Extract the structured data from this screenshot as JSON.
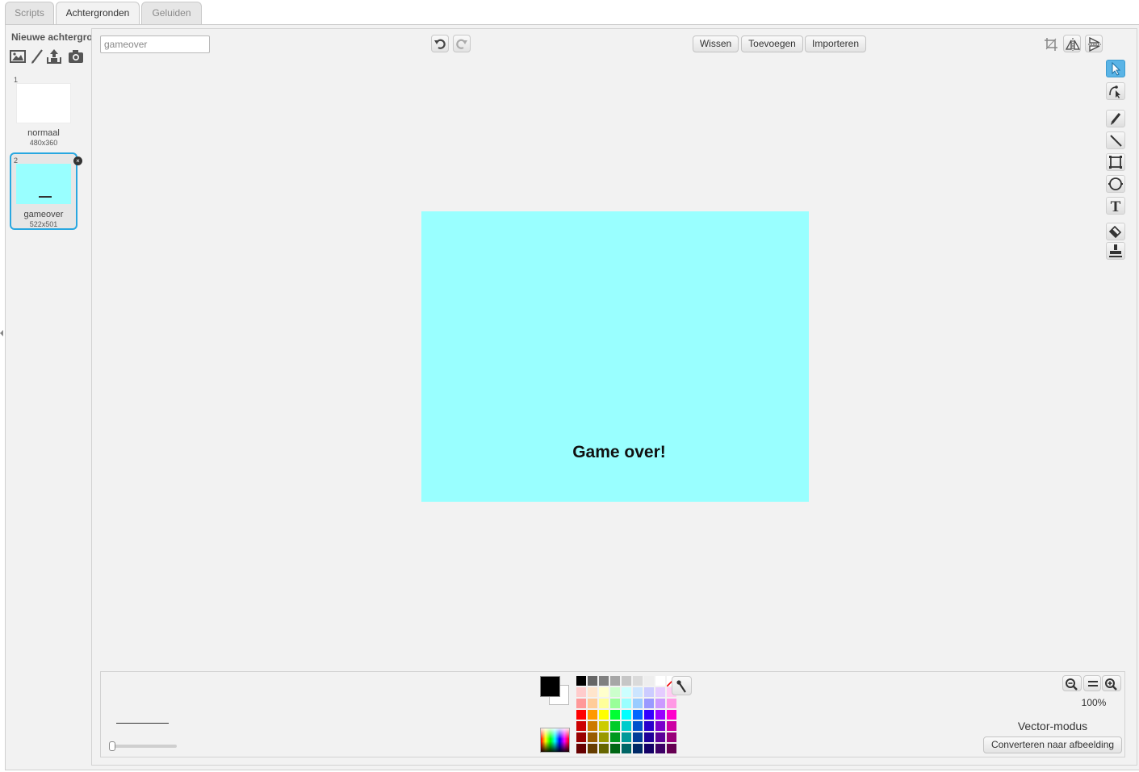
{
  "tabs": [
    {
      "label": "Scripts"
    },
    {
      "label": "Achtergronden"
    },
    {
      "label": "Geluiden"
    }
  ],
  "sidebar": {
    "new_backdrop_label": "Nieuwe achtergrond:",
    "backdrops": [
      {
        "number": "1",
        "name": "normaal",
        "size": "480x360"
      },
      {
        "number": "2",
        "name": "gameover",
        "size": "522x501"
      }
    ]
  },
  "editor": {
    "costume_name": "gameover",
    "clear_label": "Wissen",
    "add_label": "Toevoegen",
    "import_label": "Importeren",
    "canvas_text": "Game over!",
    "canvas_color": "#99ffff"
  },
  "bottom": {
    "zoom_level": "100%",
    "mode_label": "Vector-modus",
    "convert_label": "Converteren naar afbeelding",
    "primary_color": "#000000",
    "secondary_color": "#ffffff"
  },
  "palette": [
    [
      "#000000",
      "#666666",
      "#808080",
      "#a6a6a6",
      "#c6c6c6",
      "#dadada",
      "#eeeeee",
      "#ffffff",
      "none"
    ],
    [
      "#ffcccc",
      "#ffe5cc",
      "#ffffcc",
      "#ccffcc",
      "#ccffff",
      "#cce5ff",
      "#ccccff",
      "#e5ccff",
      "#ffccf2"
    ],
    [
      "#ff9999",
      "#ffcc99",
      "#ffff99",
      "#99ff99",
      "#99ffff",
      "#99ccff",
      "#9999ff",
      "#cc99ff",
      "#ff99e5"
    ],
    [
      "#ff0000",
      "#ff9900",
      "#ffff00",
      "#00ff33",
      "#00ffff",
      "#0066ff",
      "#3300ff",
      "#9900ff",
      "#ff00cc"
    ],
    [
      "#cc0000",
      "#cc7a00",
      "#cccc00",
      "#00cc29",
      "#00cccc",
      "#0052cc",
      "#2900cc",
      "#7a00cc",
      "#cc00a3"
    ],
    [
      "#990000",
      "#995c00",
      "#999900",
      "#00991f",
      "#009999",
      "#003d99",
      "#1f0099",
      "#5c0099",
      "#99007a"
    ],
    [
      "#660000",
      "#663d00",
      "#666600",
      "#006614",
      "#006666",
      "#002966",
      "#140066",
      "#3d0066",
      "#660052"
    ]
  ]
}
